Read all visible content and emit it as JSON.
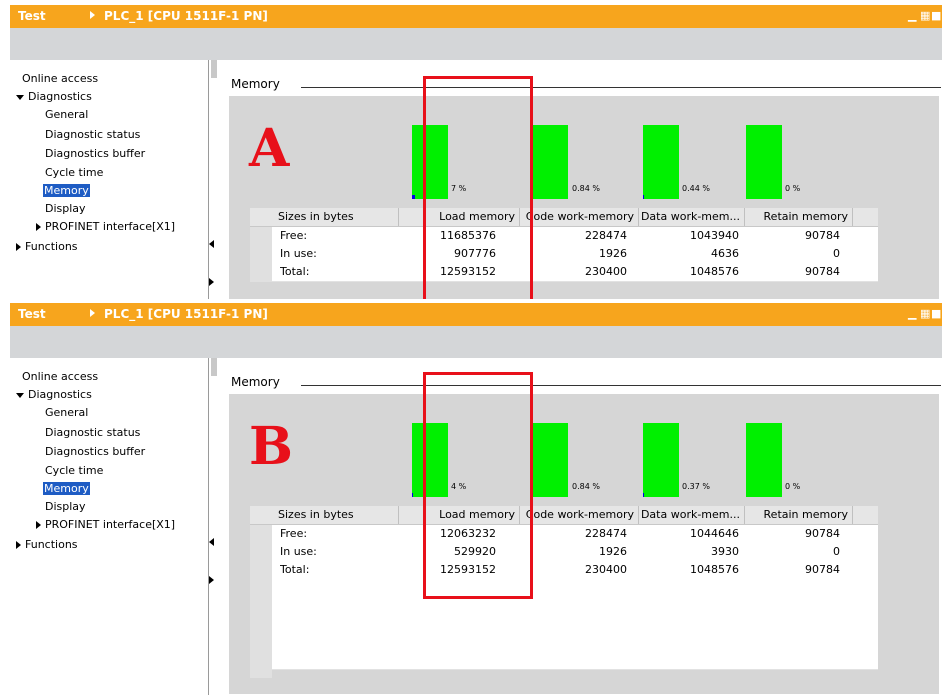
{
  "panels": [
    {
      "letter": "A",
      "titlebar": {
        "project": "Test",
        "device": "PLC_1 [CPU 1511F-1 PN]"
      },
      "nav": {
        "online_access": "Online access",
        "diagnostics": "Diagnostics",
        "general": "General",
        "diagnostic_status": "Diagnostic status",
        "diagnostics_buffer": "Diagnostics buffer",
        "cycle_time": "Cycle time",
        "memory": "Memory",
        "display": "Display",
        "profinet": "PROFINET interface[X1]",
        "functions": "Functions"
      },
      "section_title": "Memory",
      "bars": [
        {
          "label": "7 %",
          "used_fraction": 0.07
        },
        {
          "label": "0.84 %",
          "used_fraction": 0.0084
        },
        {
          "label": "0.44 %",
          "used_fraction": 0.0044
        },
        {
          "label": "0 %",
          "used_fraction": 0.0
        }
      ],
      "table": {
        "headers": [
          "Sizes in bytes",
          "Load memory",
          "Code work-memory",
          "Data work-mem...",
          "Retain memory"
        ],
        "rows": [
          [
            "Free:",
            "11685376",
            "228474",
            "1043940",
            "90784"
          ],
          [
            "In use:",
            "907776",
            "1926",
            "4636",
            "0"
          ],
          [
            "Total:",
            "12593152",
            "230400",
            "1048576",
            "90784"
          ]
        ]
      }
    },
    {
      "letter": "B",
      "titlebar": {
        "project": "Test",
        "device": "PLC_1 [CPU 1511F-1 PN]"
      },
      "nav": {
        "online_access": "Online access",
        "diagnostics": "Diagnostics",
        "general": "General",
        "diagnostic_status": "Diagnostic status",
        "diagnostics_buffer": "Diagnostics buffer",
        "cycle_time": "Cycle time",
        "memory": "Memory",
        "display": "Display",
        "profinet": "PROFINET interface[X1]",
        "functions": "Functions"
      },
      "section_title": "Memory",
      "bars": [
        {
          "label": "4 %",
          "used_fraction": 0.04
        },
        {
          "label": "0.84 %",
          "used_fraction": 0.0084
        },
        {
          "label": "0.37 %",
          "used_fraction": 0.0037
        },
        {
          "label": "0 %",
          "used_fraction": 0.0
        }
      ],
      "table": {
        "headers": [
          "Sizes in bytes",
          "Load memory",
          "Code work-memory",
          "Data work-mem...",
          "Retain memory"
        ],
        "rows": [
          [
            "Free:",
            "12063232",
            "228474",
            "1044646",
            "90784"
          ],
          [
            "In use:",
            "529920",
            "1926",
            "3930",
            "0"
          ],
          [
            "Total:",
            "12593152",
            "230400",
            "1048576",
            "90784"
          ]
        ]
      }
    }
  ],
  "colors": {
    "titlebar": "#f7a51d",
    "bar_free": "#00f000",
    "bar_used": "#0000e6",
    "highlight": "#e8101a",
    "nav_selected": "#1e5cc4"
  }
}
